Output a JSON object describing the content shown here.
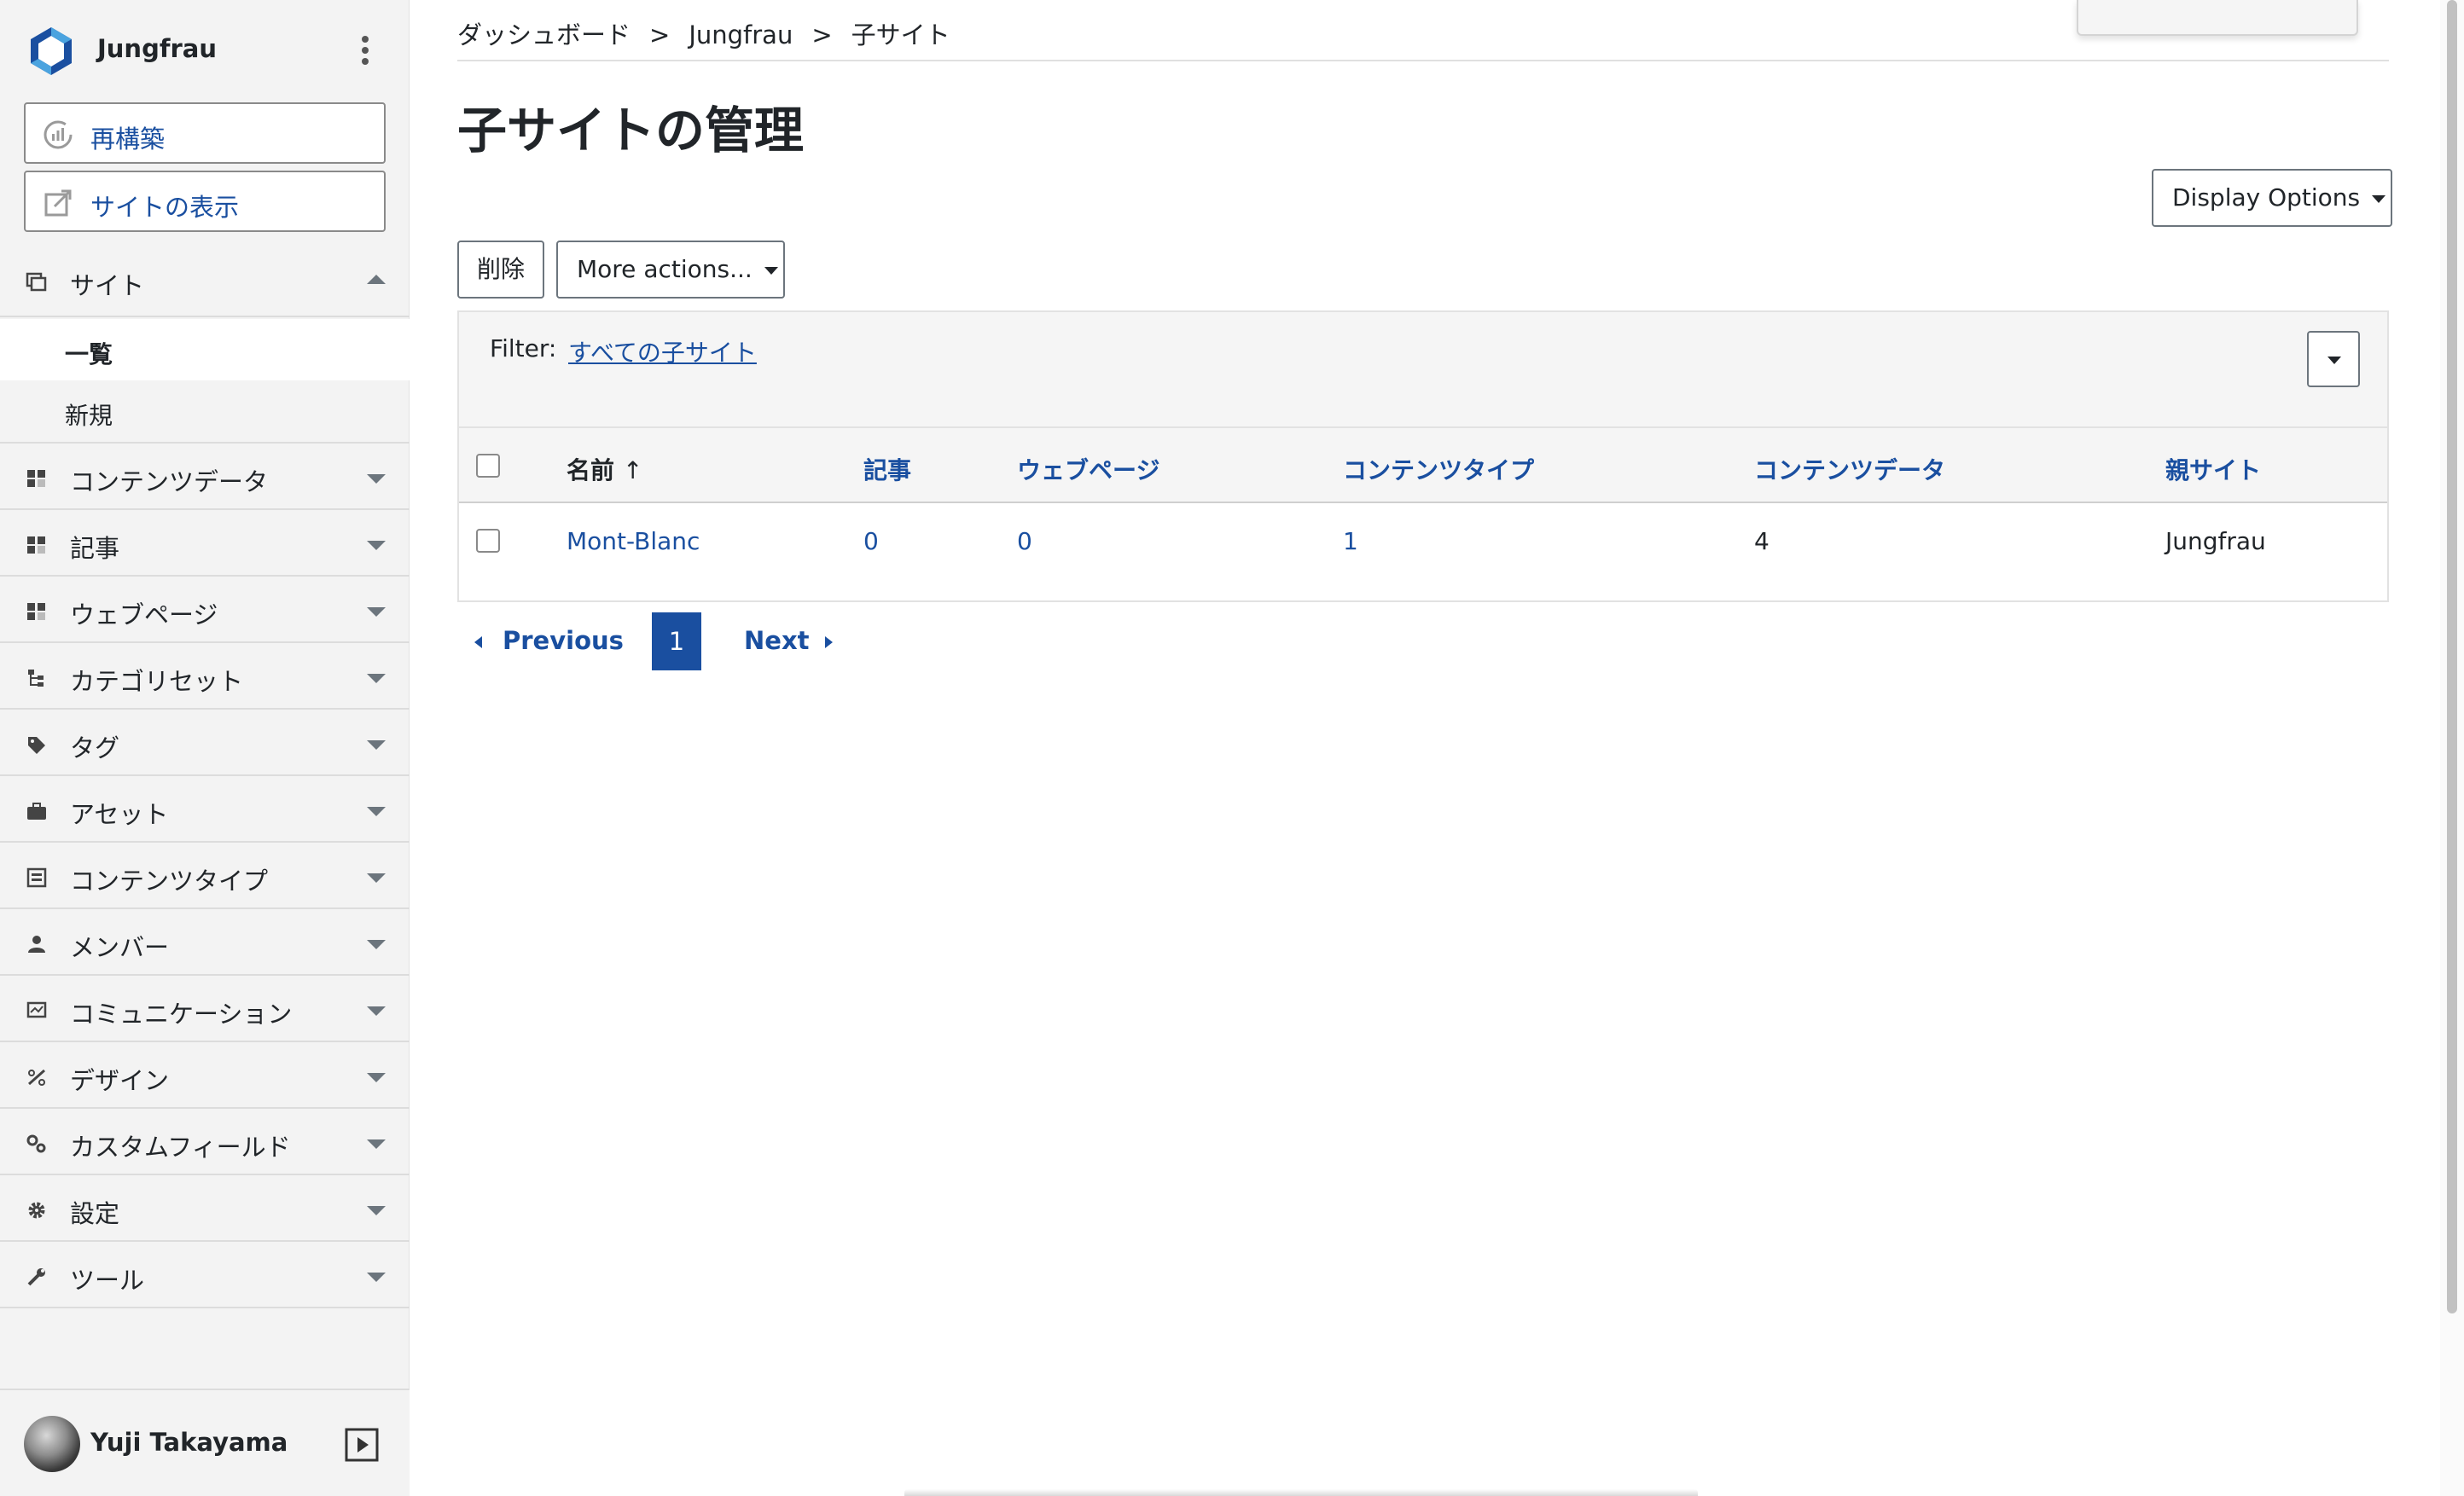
{
  "sidebar": {
    "brand_name": "Jungfrau",
    "rebuild_label": "再構築",
    "view_site_label": "サイトの表示",
    "section": {
      "label": "サイト",
      "sub_items": [
        "一覧",
        "新規"
      ],
      "active_sub": "一覧"
    },
    "nav_items": [
      {
        "label": "コンテンツデータ",
        "icon": "content-data-icon"
      },
      {
        "label": "記事",
        "icon": "entry-icon"
      },
      {
        "label": "ウェブページ",
        "icon": "webpage-icon"
      },
      {
        "label": "カテゴリセット",
        "icon": "category-set-icon"
      },
      {
        "label": "タグ",
        "icon": "tag-icon"
      },
      {
        "label": "アセット",
        "icon": "asset-icon"
      },
      {
        "label": "コンテンツタイプ",
        "icon": "content-type-icon"
      },
      {
        "label": "メンバー",
        "icon": "member-icon"
      },
      {
        "label": "コミュニケーション",
        "icon": "communication-icon"
      },
      {
        "label": "デザイン",
        "icon": "design-icon"
      },
      {
        "label": "カスタムフィールド",
        "icon": "custom-field-icon"
      },
      {
        "label": "設定",
        "icon": "settings-gear-icon"
      },
      {
        "label": "ツール",
        "icon": "tools-wrench-icon"
      }
    ],
    "user_name": "Yuji Takayama"
  },
  "breadcrumb": [
    "ダッシュボード",
    "Jungfrau",
    "子サイト"
  ],
  "breadcrumb_separator": ">",
  "page_title": "子サイトの管理",
  "toolbar": {
    "display_options_label": "Display Options",
    "delete_label": "削除",
    "more_actions_label": "More actions..."
  },
  "filter": {
    "label": "Filter:",
    "value": "すべての子サイト"
  },
  "table": {
    "columns": [
      "名前",
      "記事",
      "ウェブページ",
      "コンテンツタイプ",
      "コンテンツデータ",
      "親サイト"
    ],
    "sort_indicator": "↑",
    "rows": [
      {
        "name": "Mont-Blanc",
        "entries": "0",
        "webpages": "0",
        "content_types": "1",
        "content_data": "4",
        "parent": "Jungfrau"
      }
    ]
  },
  "pagination": {
    "previous_label": "Previous",
    "current_page": "1",
    "next_label": "Next"
  },
  "colors": {
    "link": "#1a4fa0",
    "sidebar_bg": "#f3f3f3",
    "active_page_bg": "#1a4fa0"
  }
}
